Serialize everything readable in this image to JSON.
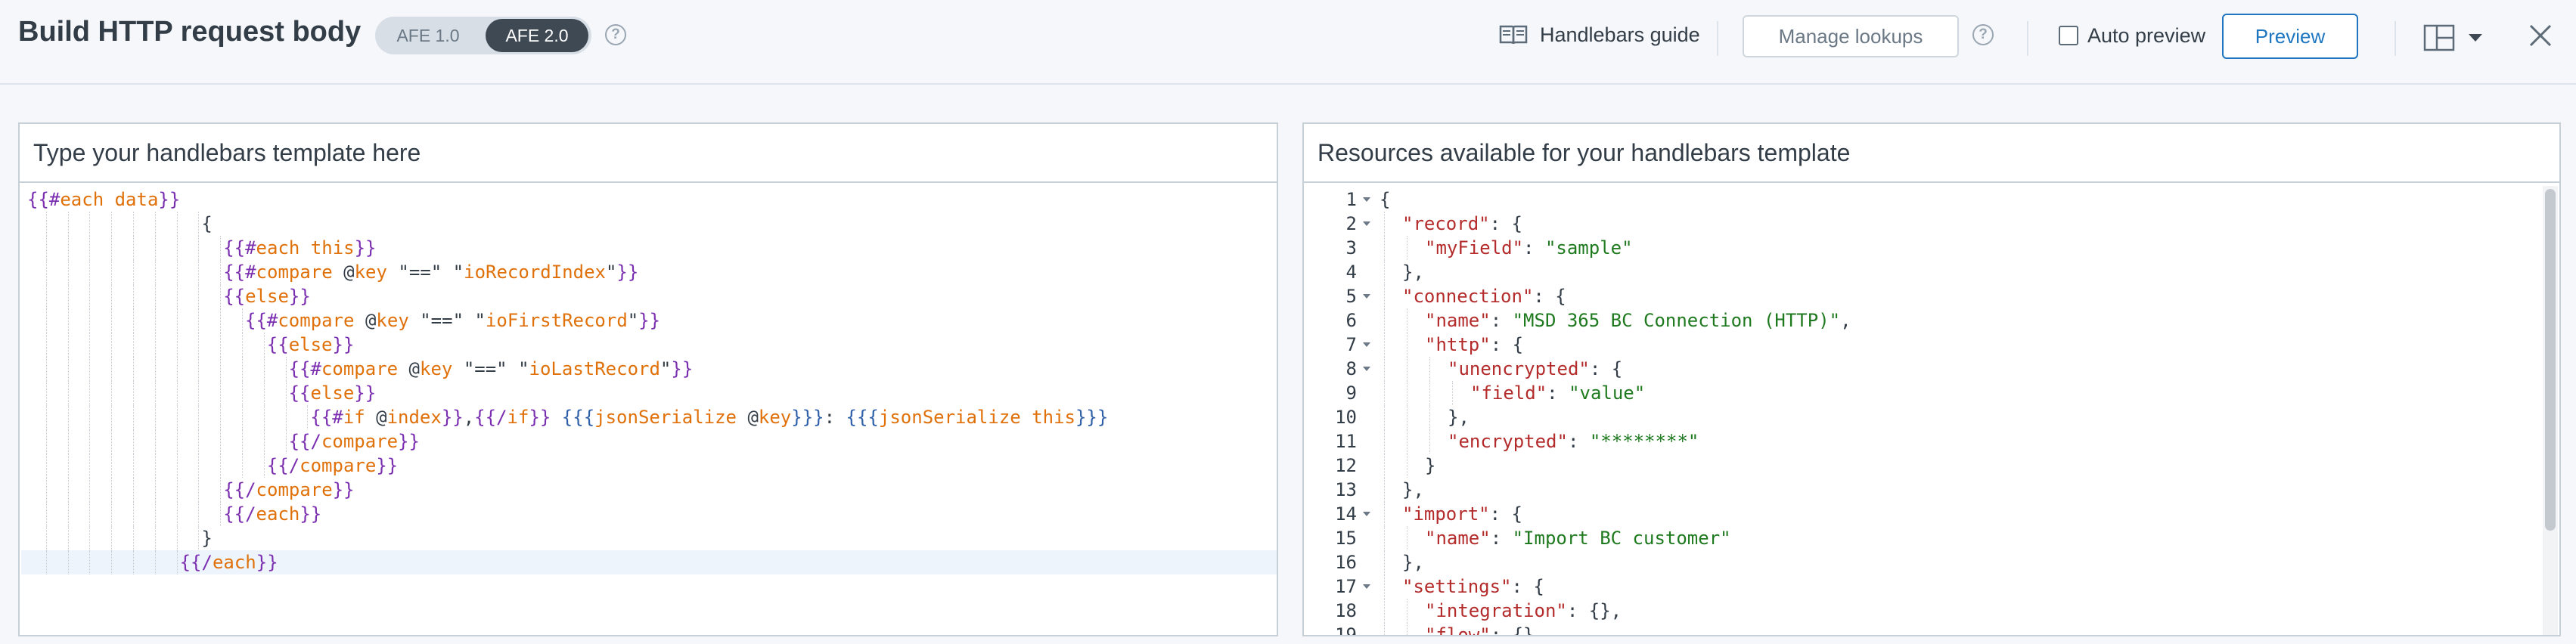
{
  "header": {
    "title": "Build HTTP request body",
    "afe_options": [
      "AFE 1.0",
      "AFE 2.0"
    ],
    "selected_afe": "AFE 2.0",
    "handlebars_guide_label": "Handlebars guide",
    "manage_lookups_label": "Manage lookups",
    "auto_preview_label": "Auto preview",
    "auto_preview_checked": false,
    "preview_label": "Preview",
    "help_glyph": "?",
    "icons": [
      "help-circle-icon",
      "book-icon",
      "layout-panels-icon",
      "chevron-down-icon",
      "close-icon"
    ]
  },
  "template_panel": {
    "title": "Type your handlebars template here",
    "lines": [
      {
        "indent": 0,
        "tokens": [
          [
            "br",
            "{{#"
          ],
          [
            "kw",
            "each"
          ],
          [
            "pl",
            " "
          ],
          [
            "kw",
            "data"
          ],
          [
            "br",
            "}}"
          ]
        ]
      },
      {
        "indent": 8,
        "tokens": [
          [
            "pl",
            "{"
          ]
        ]
      },
      {
        "indent": 9,
        "tokens": [
          [
            "br",
            "{{#"
          ],
          [
            "kw",
            "each"
          ],
          [
            "pl",
            " "
          ],
          [
            "kw",
            "this"
          ],
          [
            "br",
            "}}"
          ]
        ]
      },
      {
        "indent": 9,
        "tokens": [
          [
            "br",
            "{{#"
          ],
          [
            "kw",
            "compare"
          ],
          [
            "pl",
            " @"
          ],
          [
            "kw",
            "key"
          ],
          [
            "pl",
            " \"==\" \""
          ],
          [
            "kw",
            "ioRecordIndex"
          ],
          [
            "pl",
            "\""
          ],
          [
            "br",
            "}}"
          ]
        ]
      },
      {
        "indent": 9,
        "tokens": [
          [
            "br",
            "{{"
          ],
          [
            "kw",
            "else"
          ],
          [
            "br",
            "}}"
          ]
        ]
      },
      {
        "indent": 10,
        "tokens": [
          [
            "br",
            "{{#"
          ],
          [
            "kw",
            "compare"
          ],
          [
            "pl",
            " @"
          ],
          [
            "kw",
            "key"
          ],
          [
            "pl",
            " \"==\" \""
          ],
          [
            "kw",
            "ioFirstRecord"
          ],
          [
            "pl",
            "\""
          ],
          [
            "br",
            "}}"
          ]
        ]
      },
      {
        "indent": 11,
        "tokens": [
          [
            "br",
            "{{"
          ],
          [
            "kw",
            "else"
          ],
          [
            "br",
            "}}"
          ]
        ]
      },
      {
        "indent": 12,
        "tokens": [
          [
            "br",
            "{{#"
          ],
          [
            "kw",
            "compare"
          ],
          [
            "pl",
            " @"
          ],
          [
            "kw",
            "key"
          ],
          [
            "pl",
            " \"==\" \""
          ],
          [
            "kw",
            "ioLastRecord"
          ],
          [
            "pl",
            "\""
          ],
          [
            "br",
            "}}"
          ]
        ]
      },
      {
        "indent": 12,
        "tokens": [
          [
            "br",
            "{{"
          ],
          [
            "kw",
            "else"
          ],
          [
            "br",
            "}}"
          ]
        ]
      },
      {
        "indent": 13,
        "tokens": [
          [
            "br",
            "{{#"
          ],
          [
            "kw",
            "if"
          ],
          [
            "pl",
            " @"
          ],
          [
            "kw",
            "index"
          ],
          [
            "br",
            "}}"
          ],
          [
            "pl",
            ","
          ],
          [
            "br",
            "{{/"
          ],
          [
            "kw",
            "if"
          ],
          [
            "br",
            "}}"
          ],
          [
            "pl",
            " "
          ],
          [
            "sp",
            "{{{"
          ],
          [
            "kw",
            "jsonSerialize"
          ],
          [
            "pl",
            " @"
          ],
          [
            "kw",
            "key"
          ],
          [
            "sp",
            "}}}"
          ],
          [
            "pl",
            ": "
          ],
          [
            "sp",
            "{{{"
          ],
          [
            "kw",
            "jsonSerialize"
          ],
          [
            "pl",
            " "
          ],
          [
            "kw",
            "this"
          ],
          [
            "sp",
            "}}}"
          ]
        ]
      },
      {
        "indent": 12,
        "tokens": [
          [
            "br",
            "{{/"
          ],
          [
            "kw",
            "compare"
          ],
          [
            "br",
            "}}"
          ]
        ]
      },
      {
        "indent": 11,
        "tokens": [
          [
            "br",
            "{{/"
          ],
          [
            "kw",
            "compare"
          ],
          [
            "br",
            "}}"
          ]
        ]
      },
      {
        "indent": 9,
        "tokens": [
          [
            "br",
            "{{/"
          ],
          [
            "kw",
            "compare"
          ],
          [
            "br",
            "}}"
          ]
        ]
      },
      {
        "indent": 9,
        "tokens": [
          [
            "br",
            "{{/"
          ],
          [
            "kw",
            "each"
          ],
          [
            "br",
            "}}"
          ]
        ]
      },
      {
        "indent": 8,
        "tokens": [
          [
            "pl",
            "}"
          ]
        ]
      },
      {
        "indent": 7,
        "tokens": [
          [
            "br",
            "{{/"
          ],
          [
            "kw",
            "each"
          ],
          [
            "br",
            "}}"
          ]
        ]
      }
    ]
  },
  "resources_panel": {
    "title": "Resources available for your handlebars template",
    "lines": [
      {
        "n": "1",
        "fold": true,
        "indent": 0,
        "tokens": [
          [
            "pn",
            "{"
          ]
        ]
      },
      {
        "n": "2",
        "fold": true,
        "indent": 1,
        "tokens": [
          [
            "key",
            "\"record\""
          ],
          [
            "pn",
            ": {"
          ]
        ]
      },
      {
        "n": "3",
        "fold": false,
        "indent": 2,
        "tokens": [
          [
            "key",
            "\"myField\""
          ],
          [
            "pn",
            ": "
          ],
          [
            "str",
            "\"sample\""
          ]
        ]
      },
      {
        "n": "4",
        "fold": false,
        "indent": 1,
        "tokens": [
          [
            "pn",
            "},"
          ]
        ]
      },
      {
        "n": "5",
        "fold": true,
        "indent": 1,
        "tokens": [
          [
            "key",
            "\"connection\""
          ],
          [
            "pn",
            ": {"
          ]
        ]
      },
      {
        "n": "6",
        "fold": false,
        "indent": 2,
        "tokens": [
          [
            "key",
            "\"name\""
          ],
          [
            "pn",
            ": "
          ],
          [
            "str",
            "\"MSD 365 BC Connection (HTTP)\""
          ],
          [
            "pn",
            ","
          ]
        ]
      },
      {
        "n": "7",
        "fold": true,
        "indent": 2,
        "tokens": [
          [
            "key",
            "\"http\""
          ],
          [
            "pn",
            ": {"
          ]
        ]
      },
      {
        "n": "8",
        "fold": true,
        "indent": 3,
        "tokens": [
          [
            "key",
            "\"unencrypted\""
          ],
          [
            "pn",
            ": {"
          ]
        ]
      },
      {
        "n": "9",
        "fold": false,
        "indent": 4,
        "tokens": [
          [
            "key",
            "\"field\""
          ],
          [
            "pn",
            ": "
          ],
          [
            "str",
            "\"value\""
          ]
        ]
      },
      {
        "n": "10",
        "fold": false,
        "indent": 3,
        "tokens": [
          [
            "pn",
            "},"
          ]
        ]
      },
      {
        "n": "11",
        "fold": false,
        "indent": 3,
        "tokens": [
          [
            "key",
            "\"encrypted\""
          ],
          [
            "pn",
            ": "
          ],
          [
            "str",
            "\"********\""
          ]
        ]
      },
      {
        "n": "12",
        "fold": false,
        "indent": 2,
        "tokens": [
          [
            "pn",
            "}"
          ]
        ]
      },
      {
        "n": "13",
        "fold": false,
        "indent": 1,
        "tokens": [
          [
            "pn",
            "},"
          ]
        ]
      },
      {
        "n": "14",
        "fold": true,
        "indent": 1,
        "tokens": [
          [
            "key",
            "\"import\""
          ],
          [
            "pn",
            ": {"
          ]
        ]
      },
      {
        "n": "15",
        "fold": false,
        "indent": 2,
        "tokens": [
          [
            "key",
            "\"name\""
          ],
          [
            "pn",
            ": "
          ],
          [
            "str",
            "\"Import BC customer\""
          ]
        ]
      },
      {
        "n": "16",
        "fold": false,
        "indent": 1,
        "tokens": [
          [
            "pn",
            "},"
          ]
        ]
      },
      {
        "n": "17",
        "fold": true,
        "indent": 1,
        "tokens": [
          [
            "key",
            "\"settings\""
          ],
          [
            "pn",
            ": {"
          ]
        ]
      },
      {
        "n": "18",
        "fold": false,
        "indent": 2,
        "tokens": [
          [
            "key",
            "\"integration\""
          ],
          [
            "pn",
            ": {},"
          ]
        ]
      },
      {
        "n": "19",
        "fold": false,
        "indent": 2,
        "tokens": [
          [
            "key",
            "\"flow\""
          ],
          [
            "pn",
            ": {},"
          ]
        ]
      }
    ]
  },
  "colors": {
    "accent": "#1d76c0",
    "toggle_selected_bg": "#3e4954",
    "handlebars_bracket": "#7b2fb0",
    "handlebars_keyword": "#e0710a",
    "json_key": "#b42b2b",
    "json_string": "#1f7a1f"
  }
}
